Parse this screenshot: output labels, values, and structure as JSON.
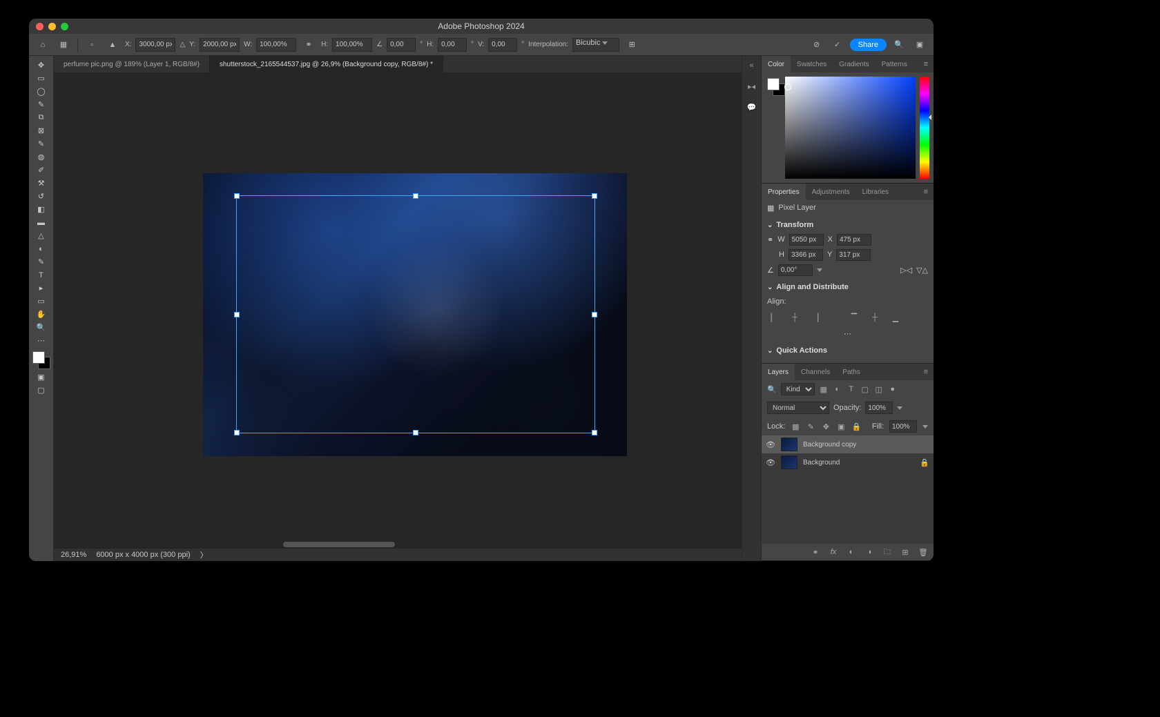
{
  "app_title": "Adobe Photoshop 2024",
  "options": {
    "x_label": "X:",
    "x": "3000,00 px",
    "y_label": "Y:",
    "y": "2000,00 px",
    "w_label": "W:",
    "w": "100,00%",
    "h_label": "H:",
    "h": "100,00%",
    "angle": "0,00",
    "hskew_label": "H:",
    "hskew": "0,00",
    "vskew_label": "V:",
    "vskew": "0,00",
    "interp_label": "Interpolation:",
    "interp": "Bicubic"
  },
  "share": "Share",
  "doc_tabs": [
    "perfume pic.png @ 189% (Layer 1, RGB/8#)",
    "shutterstock_2165544537.jpg @ 26,9% (Background copy, RGB/8#) *"
  ],
  "status": {
    "zoom": "26,91%",
    "doc": "6000 px x 4000 px (300 ppi)"
  },
  "panels": {
    "color_tabs": [
      "Color",
      "Swatches",
      "Gradients",
      "Patterns"
    ],
    "props_tabs": [
      "Properties",
      "Adjustments",
      "Libraries"
    ],
    "pixel_layer": "Pixel Layer",
    "transform_hdr": "Transform",
    "w_label": "W",
    "w": "5050 px",
    "x_label": "X",
    "x": "475 px",
    "h_label": "H",
    "h": "3366 px",
    "y_label": "Y",
    "y": "317 px",
    "angle": "0,00°",
    "align_hdr": "Align and Distribute",
    "align_label": "Align:",
    "quick_hdr": "Quick Actions",
    "layers_tabs": [
      "Layers",
      "Channels",
      "Paths"
    ],
    "kind": "Kind",
    "blend": "Normal",
    "opacity_label": "Opacity:",
    "opacity": "100%",
    "lock_label": "Lock:",
    "fill_label": "Fill:",
    "fill": "100%",
    "layers": [
      {
        "name": "Background copy",
        "selected": true,
        "locked": false
      },
      {
        "name": "Background",
        "selected": false,
        "locked": true
      }
    ]
  }
}
